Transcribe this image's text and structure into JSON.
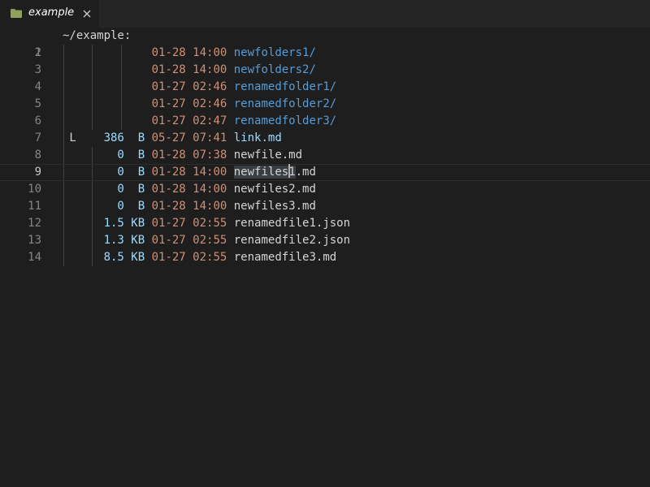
{
  "tab": {
    "label": "example",
    "folder_color": "#8fa15a"
  },
  "editor": {
    "path": "~/example:",
    "cursor_line": 9,
    "entries": [
      {
        "flag": "",
        "size": "",
        "unit": "",
        "date": "01-28 14:00",
        "name": "newfolders1/",
        "kind": "dir"
      },
      {
        "flag": "",
        "size": "",
        "unit": "",
        "date": "01-28 14:00",
        "name": "newfolders2/",
        "kind": "dir"
      },
      {
        "flag": "",
        "size": "",
        "unit": "",
        "date": "01-27 02:46",
        "name": "renamedfolder1/",
        "kind": "dir"
      },
      {
        "flag": "",
        "size": "",
        "unit": "",
        "date": "01-27 02:46",
        "name": "renamedfolder2/",
        "kind": "dir"
      },
      {
        "flag": "",
        "size": "",
        "unit": "",
        "date": "01-27 02:47",
        "name": "renamedfolder3/",
        "kind": "dir"
      },
      {
        "flag": "L",
        "size": "386",
        "unit": "B",
        "date": "05-27 07:41",
        "name": "link.md",
        "kind": "link"
      },
      {
        "flag": "",
        "size": "0",
        "unit": "B",
        "date": "01-28 07:38",
        "name": "newfile.md",
        "kind": "file"
      },
      {
        "flag": "",
        "size": "0",
        "unit": "B",
        "date": "01-28 14:00",
        "name": "newfiles1.md",
        "kind": "file"
      },
      {
        "flag": "",
        "size": "0",
        "unit": "B",
        "date": "01-28 14:00",
        "name": "newfiles2.md",
        "kind": "file"
      },
      {
        "flag": "",
        "size": "0",
        "unit": "B",
        "date": "01-28 14:00",
        "name": "newfiles3.md",
        "kind": "file"
      },
      {
        "flag": "",
        "size": "1.5",
        "unit": "KB",
        "date": "01-27 02:55",
        "name": "renamedfile1.json",
        "kind": "file"
      },
      {
        "flag": "",
        "size": "1.3",
        "unit": "KB",
        "date": "01-27 02:55",
        "name": "renamedfile2.json",
        "kind": "file"
      },
      {
        "flag": "",
        "size": "8.5",
        "unit": "KB",
        "date": "01-27 02:55",
        "name": "renamedfile3.md",
        "kind": "file"
      }
    ]
  }
}
